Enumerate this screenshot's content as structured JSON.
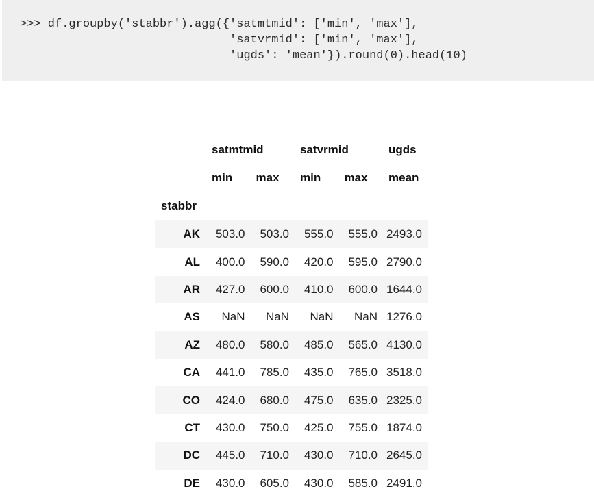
{
  "code": {
    "lines": [
      ">>> df.groupby('stabbr').agg({'satmtmid': ['min', 'max'],",
      "                              'satvrmid': ['min', 'max'],",
      "                              'ugds': 'mean'}).round(0).head(10)"
    ]
  },
  "table": {
    "top_headers": [
      "satmtmid",
      "satvrmid",
      "ugds"
    ],
    "sub_headers": [
      "min",
      "max",
      "min",
      "max",
      "mean"
    ],
    "index_name": "stabbr",
    "rows": [
      {
        "index": "AK",
        "values": [
          "503.0",
          "503.0",
          "555.0",
          "555.0",
          "2493.0"
        ]
      },
      {
        "index": "AL",
        "values": [
          "400.0",
          "590.0",
          "420.0",
          "595.0",
          "2790.0"
        ]
      },
      {
        "index": "AR",
        "values": [
          "427.0",
          "600.0",
          "410.0",
          "600.0",
          "1644.0"
        ]
      },
      {
        "index": "AS",
        "values": [
          "NaN",
          "NaN",
          "NaN",
          "NaN",
          "1276.0"
        ]
      },
      {
        "index": "AZ",
        "values": [
          "480.0",
          "580.0",
          "485.0",
          "565.0",
          "4130.0"
        ]
      },
      {
        "index": "CA",
        "values": [
          "441.0",
          "785.0",
          "435.0",
          "765.0",
          "3518.0"
        ]
      },
      {
        "index": "CO",
        "values": [
          "424.0",
          "680.0",
          "475.0",
          "635.0",
          "2325.0"
        ]
      },
      {
        "index": "CT",
        "values": [
          "430.0",
          "750.0",
          "425.0",
          "755.0",
          "1874.0"
        ]
      },
      {
        "index": "DC",
        "values": [
          "445.0",
          "710.0",
          "430.0",
          "710.0",
          "2645.0"
        ]
      },
      {
        "index": "DE",
        "values": [
          "430.0",
          "605.0",
          "430.0",
          "585.0",
          "2491.0"
        ]
      }
    ]
  }
}
